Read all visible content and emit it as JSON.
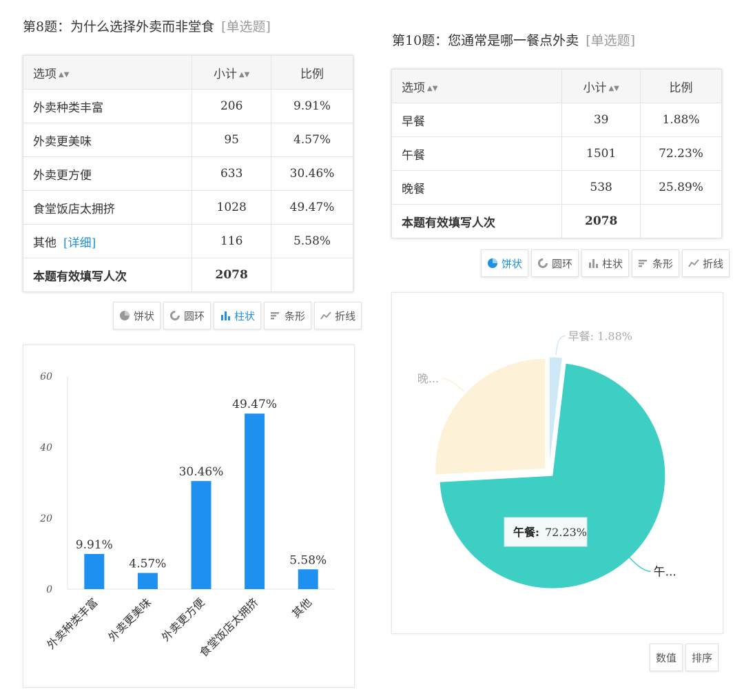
{
  "q8": {
    "title": "第8题：为什么选择外卖而非堂食",
    "qtype": "[单选题]",
    "headers": {
      "option": "选项",
      "count": "小计",
      "ratio": "比例"
    },
    "rows": [
      {
        "option": "外卖种类丰富",
        "count": "206",
        "ratio": "9.91%"
      },
      {
        "option": "外卖更美味",
        "count": "95",
        "ratio": "4.57%"
      },
      {
        "option": "外卖更方便",
        "count": "633",
        "ratio": "30.46%"
      },
      {
        "option": "食堂饭店太拥挤",
        "count": "1028",
        "ratio": "49.47%"
      },
      {
        "option": "其他",
        "count": "116",
        "ratio": "5.58%"
      }
    ],
    "detail_link": "[详细]",
    "total_label": "本题有效填写人次",
    "total_value": "2078",
    "toolbar": [
      "饼状",
      "圆环",
      "柱状",
      "条形",
      "折线"
    ],
    "active_tool": "柱状"
  },
  "q10": {
    "title": "第10题：您通常是哪一餐点外卖",
    "qtype": "[单选题]",
    "headers": {
      "option": "选项",
      "count": "小计",
      "ratio": "比例"
    },
    "rows": [
      {
        "option": "早餐",
        "count": "39",
        "ratio": "1.88%"
      },
      {
        "option": "午餐",
        "count": "1501",
        "ratio": "72.23%"
      },
      {
        "option": "晚餐",
        "count": "538",
        "ratio": "25.89%"
      }
    ],
    "total_label": "本题有效填写人次",
    "total_value": "2078",
    "toolbar": [
      "饼状",
      "圆环",
      "柱状",
      "条形",
      "折线"
    ],
    "active_tool": "饼状",
    "bottom_buttons": [
      "数值",
      "排序"
    ]
  },
  "chart_data": [
    {
      "type": "bar",
      "categories": [
        "外卖种类丰富",
        "外卖更美味",
        "外卖更方便",
        "食堂饭店太拥挤",
        "其他"
      ],
      "values": [
        9.91,
        4.57,
        30.46,
        49.47,
        5.58
      ],
      "data_labels": [
        "9.91%",
        "4.57%",
        "30.46%",
        "49.47%",
        "5.58%"
      ],
      "yticks": [
        "0",
        "20",
        "40",
        "60"
      ],
      "ylim": [
        0,
        60
      ],
      "bar_color": "#1e90f0",
      "grid": false
    },
    {
      "type": "pie",
      "categories": [
        "早餐",
        "午餐",
        "晚餐"
      ],
      "values": [
        1.88,
        72.23,
        25.89
      ],
      "colors": [
        "#cfe8f8",
        "#3dcfc4",
        "#fdf2d8"
      ],
      "slice_labels": [
        "早餐: 1.88%",
        "午...",
        "晚..."
      ],
      "highlighted": "午餐",
      "tooltip_label": "午餐:",
      "tooltip_value": "72.23%"
    }
  ]
}
